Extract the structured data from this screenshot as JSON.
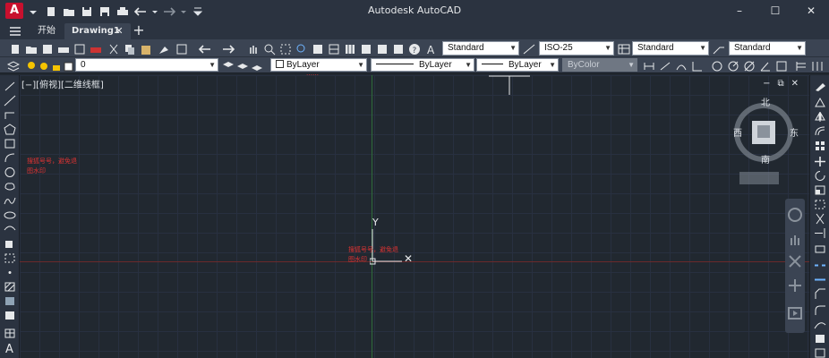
{
  "app": {
    "logo_letter": "A",
    "title": "Autodesk AutoCAD",
    "window_controls": [
      "–",
      "☐",
      "✕"
    ]
  },
  "tabs": {
    "start_label": "开始",
    "active_label": "Drawing1",
    "close_glyph": "✕",
    "add_glyph": "+"
  },
  "toolbar1": {
    "text_style": "Standard",
    "dim_style": "ISO-25",
    "table_style": "Standard",
    "mleader_style": "Standard"
  },
  "toolbar2": {
    "layer_value": "0",
    "color": "ByLayer",
    "linetype": "ByLayer",
    "lineweight": "ByLayer",
    "plotstyle": "ByColor"
  },
  "viewport": {
    "label": "[−][俯视][二维线框]",
    "controls": [
      "−",
      "⧉",
      "✕"
    ]
  },
  "canvas_marks": {
    "ucs_y_label": "Y",
    "ucs_x_label": "✕",
    "red_text_left": [
      "搜狐号号，避免退",
      "图水印"
    ],
    "red_text_center": [
      "搜狐号号，避免退",
      "图水印"
    ],
    "red_text_top": "……"
  },
  "viewcube": {
    "north": "北",
    "west": "西",
    "south": "南",
    "east": "东"
  },
  "colors": {
    "titlebar": "#2b3340",
    "toolbar": "#3b4453",
    "canvas": "#212830",
    "grid": "#283040",
    "y_axis": "#2f6b3a",
    "x_axis": "#6b2a2a",
    "logo": "#c8102e"
  }
}
